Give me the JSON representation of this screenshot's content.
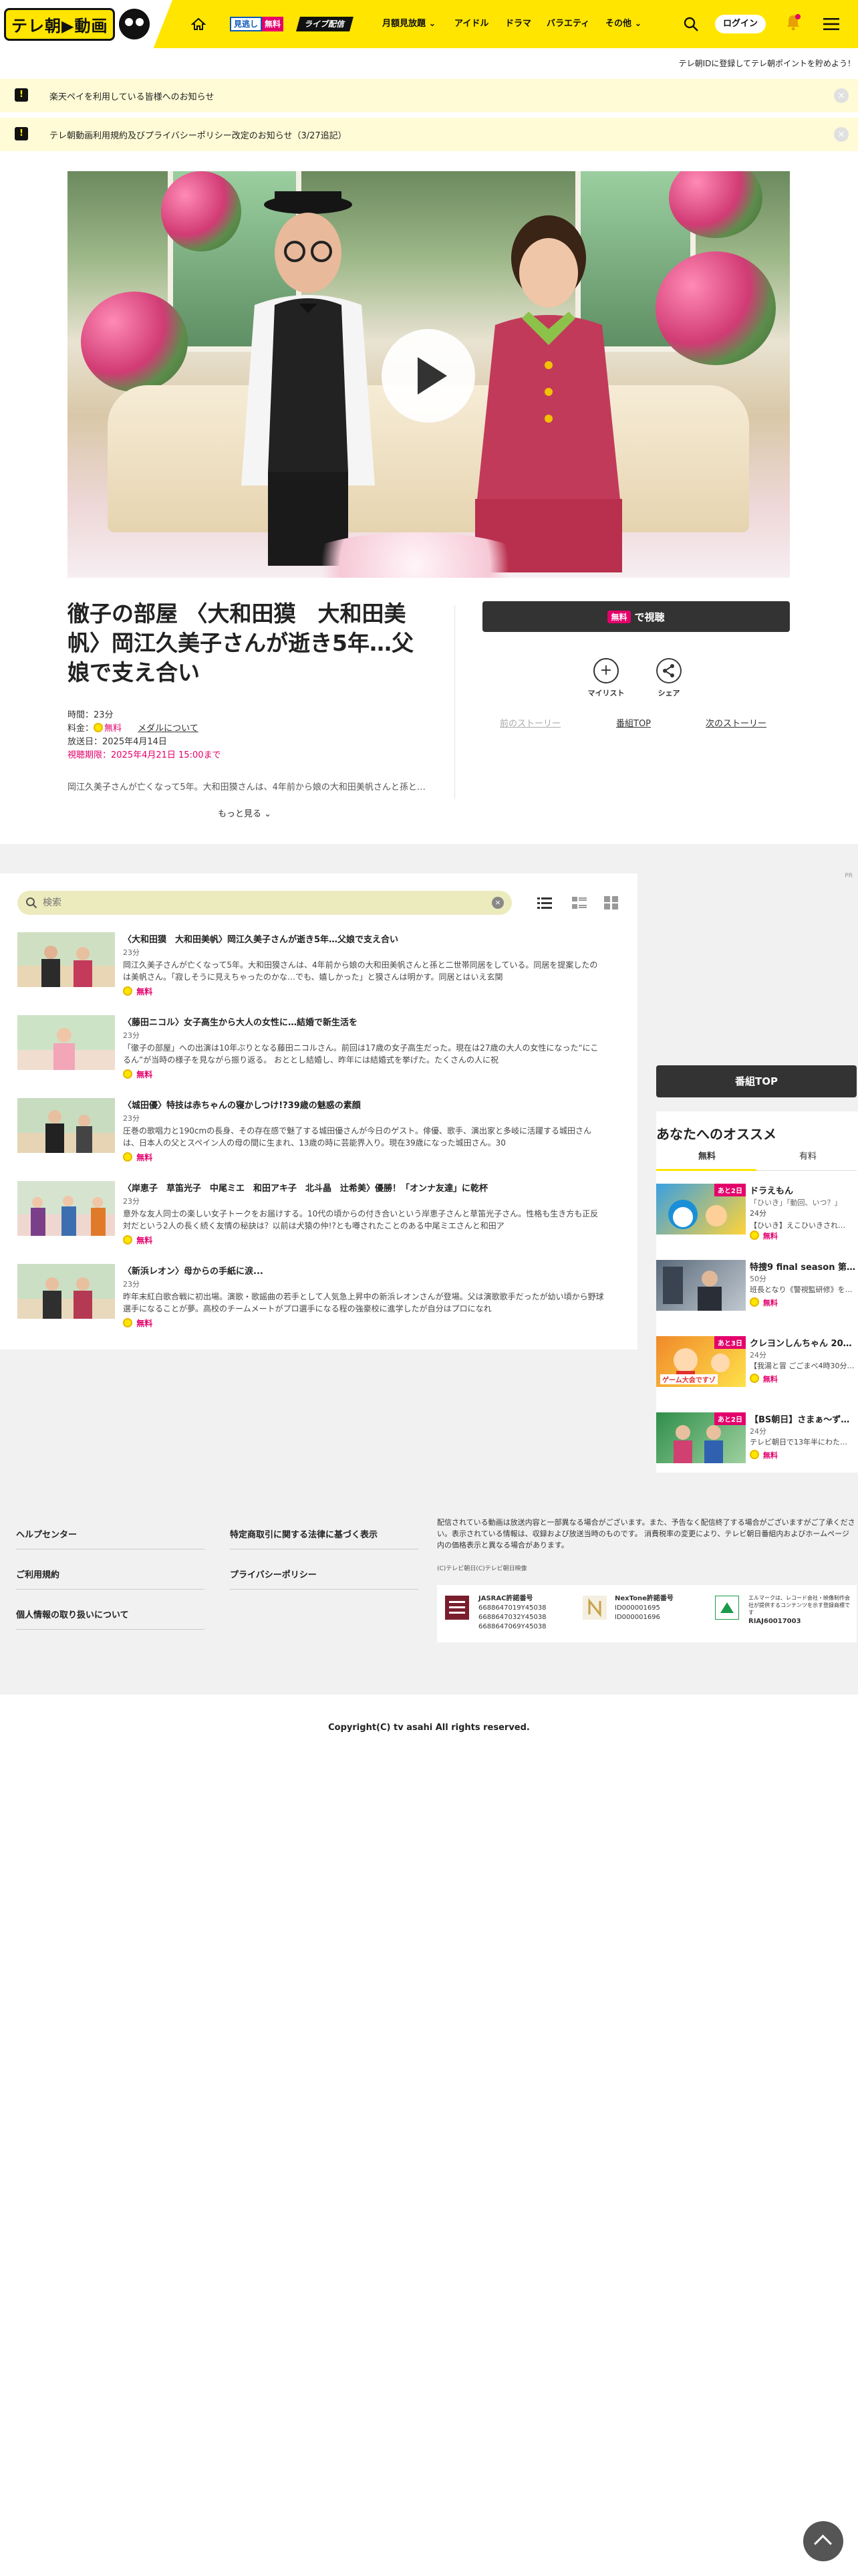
{
  "header": {
    "logo_text": "テレ朝▶動画",
    "minogashi_a": "見逃し",
    "minogashi_b": "無料",
    "live_label": "ライブ配信",
    "nav": [
      "月額見放題",
      "アイドル",
      "ドラマ",
      "バラエティ",
      "その他"
    ],
    "login": "ログイン",
    "point_link": "テレ朝IDに登録してテレ朝ポイントを貯めよう！"
  },
  "notices": [
    "楽天ペイを利用している皆様へのお知らせ",
    "テレ朝動画利用規約及びプライバシーポリシー改定のお知らせ（3/27追記）"
  ],
  "episode": {
    "title": "徹子の部屋 〈大和田獏　大和田美帆〉岡江久美子さんが逝き5年…父娘で支え合い",
    "duration": "時間：23分",
    "price_label": "料金：",
    "price_value": "無料",
    "medal_link": "メダルについて",
    "aired": "放送日：2025年4月14日",
    "deadline": "視聴期限：2025年4月21日 15:00まで",
    "description": "岡江久美子さんが亡くなって5年。大和田獏さんは、4年前から娘の大和田美帆さんと孫と二世帯同居をしている。",
    "more": "もっと見る"
  },
  "actions": {
    "watch_free": "無料",
    "watch_label": "で視聴",
    "mylist": "マイリスト",
    "share": "シェア",
    "prev_story": "前のストーリー",
    "program_top": "番組TOP",
    "next_story": "次のストーリー"
  },
  "ad_mark": "PR",
  "list": {
    "search_placeholder": "検索",
    "items": [
      {
        "title": "〈大和田獏　大和田美帆〉岡江久美子さんが逝き5年…父娘で支え合い",
        "duration": "23分",
        "desc": "岡江久美子さんが亡くなって5年。大和田獏さんは、4年前から娘の大和田美帆さんと孫と二世帯同居をしている。同居を提案したのは美帆さん。「寂しそうに見えちゃったのかな…でも、嬉しかった」と獏さんは明かす。同居とはいえ玄関",
        "free": "無料"
      },
      {
        "title": "〈藤田ニコル〉女子高生から大人の女性に…結婚で新生活を",
        "duration": "23分",
        "desc": "「徹子の部屋」への出演は10年ぶりとなる藤田ニコルさん。前回は17歳の女子高生だった。現在は27歳の大人の女性になった“にこるん”が当時の様子を見ながら振り返る。 おととし結婚し、昨年には結婚式を挙げた。たくさんの人に祝",
        "free": "無料"
      },
      {
        "title": "〈城田優〉特技は赤ちゃんの寝かしつけ!?39歳の魅惑の素顔",
        "duration": "23分",
        "desc": "圧巻の歌唱力と190cmの長身、その存在感で魅了する城田優さんが今日のゲスト。俳優、歌手、演出家と多岐に活躍する城田さんは、日本人の父とスペイン人の母の間に生まれ、13歳の時に芸能界入り。現在39歳になった城田さん。30",
        "free": "無料"
      },
      {
        "title": "〈岸恵子　草笛光子　中尾ミエ　和田アキ子　北斗晶　辻希美〉優勝！「オンナ友達」に乾杯",
        "duration": "23分",
        "desc": "意外な友人同士の楽しい女子トークをお届けする。10代の頃からの付き合いという岸恵子さんと草笛光子さん。性格も生き方も正反対だという2人の長く続く友情の秘訣は？以前は犬猿の仲!?とも噂されたことのある中尾ミエさんと和田ア",
        "free": "無料"
      },
      {
        "title": "〈新浜レオン〉母からの手紙に涙...",
        "duration": "23分",
        "desc": "昨年末紅白歌合戦に初出場。演歌・歌謡曲の若手として人気急上昇中の新浜レオンさんが登場。父は演歌歌手だったが幼い頃から野球選手になることが夢。高校のチームメートがプロ選手になる程の強豪校に進学したが自分はプロになれ",
        "free": "無料"
      }
    ]
  },
  "sidebar": {
    "program_top": "番組TOP",
    "rec_heading": "あなたへのオススメ",
    "tab_free": "無料",
    "tab_paid": "有料",
    "items": [
      {
        "badge": "あと2日",
        "title": "ドラえもん",
        "duration": "24分",
        "desc": "【ひいき】えこひいきされ…",
        "free": "無料",
        "c1": "#3aa0e0",
        "c2": "#ffd33a",
        "sub": "「ひいき」「動回、いつ？」"
      },
      {
        "badge": "",
        "title": "特捜9 final season 第1話 拡大スペシャル「さま…",
        "duration": "50分",
        "desc": "班長となり《警視監研修》を…",
        "free": "無料",
        "c1": "#5a6a7a",
        "c2": "#c0c8d0",
        "sub": ""
      },
      {
        "badge": "あと3日",
        "title": "クレヨンしんちゃん 2025年4月12日放送「我家…",
        "duration": "24分",
        "desc": "【我湯と冒 ごごまべ4時30分から…",
        "free": "無料",
        "c1": "#f08a2a",
        "c2": "#ffe14a",
        "sub": "ゲーム大会ですゾ"
      },
      {
        "badge": "あと2日",
        "title": "【BS朝日】さまぁ～ず… #1【2025年4月12日放送】",
        "duration": "24分",
        "desc": "テレビ朝日で13年半にわた…",
        "free": "無料",
        "c1": "#2f8f4a",
        "c2": "#9fd0a0",
        "sub": ""
      }
    ]
  },
  "footer": {
    "links_left": [
      "ヘルプセンター",
      "ご利用規約",
      "個人情報の取り扱いについて"
    ],
    "links_right": [
      "特定商取引に関する法律に基づく表示",
      "プライバシーポリシー"
    ],
    "notice": "配信されている動画は放送内容と一部異なる場合がございます。また、予告なく配信終了する場合がございますがご了承ください。表示されている情報は、収録および放送当時のものです。 消費税率の変更により、テレビ朝日番組内およびホームページ内の価格表示と異なる場合があります。",
    "small_copy": "(C)テレビ朝日(C)テレビ朝日映像",
    "jasrac_title": "JASRAC許諾番号",
    "jasrac_nums": [
      "6688647019Y45038",
      "6688647032Y45038",
      "6688647069Y45038"
    ],
    "nextone_title": "NexTone許諾番号",
    "nextone_nums": [
      "ID000001695",
      "ID000001696"
    ],
    "riaj_text": "エルマークは、レコード会社・映像制作会社が提供するコンテンツを示す登録商標です",
    "riaj_num": "RIAJ60017003",
    "copyright": "Copyright(C) tv asahi All rights reserved."
  }
}
